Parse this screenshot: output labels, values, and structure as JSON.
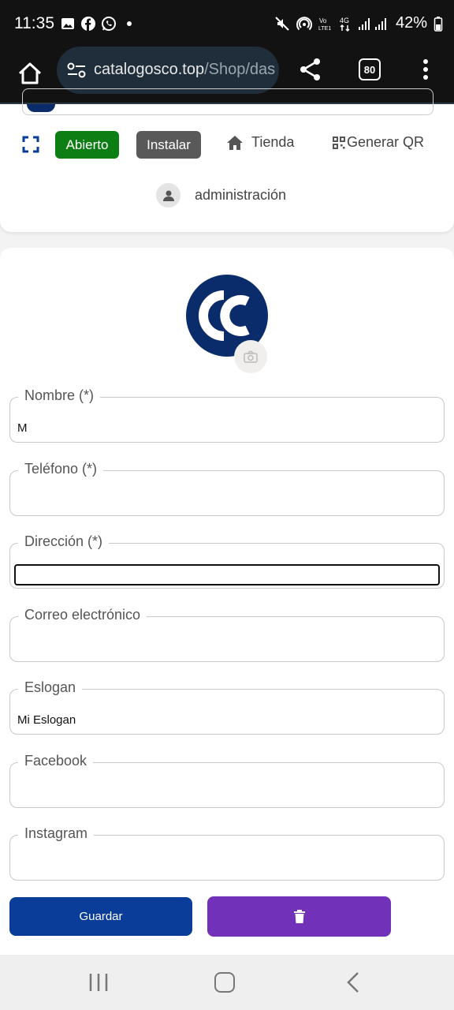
{
  "status_bar": {
    "time": "11:35",
    "battery": "42%",
    "icons": [
      "gallery-icon",
      "facebook-icon",
      "whatsapp-icon",
      "dot-icon",
      "mute-icon",
      "hotspot-icon",
      "volte-icon",
      "4g-icon",
      "signal-icon",
      "battery-icon"
    ]
  },
  "browser": {
    "url_host": "catalogosco.top",
    "url_path": "/Shop/das",
    "tab_count": "80"
  },
  "toolbar": {
    "status_label": "Abierto",
    "install_label": "Instalar",
    "store_label": "Tienda",
    "qr_label": "Generar QR",
    "admin_label": "administración"
  },
  "form": {
    "fields": [
      {
        "label": "Nombre (*)",
        "value": "M"
      },
      {
        "label": "Teléfono (*)",
        "value": ""
      },
      {
        "label": "Dirección (*)",
        "value": ""
      },
      {
        "label": "Correo electrónico",
        "value": ""
      },
      {
        "label": "Eslogan",
        "value": "Mi Eslogan"
      },
      {
        "label": "Facebook",
        "value": ""
      },
      {
        "label": "Instagram",
        "value": ""
      }
    ],
    "save_label": "Guardar"
  },
  "colors": {
    "status_open": "#0d7e13",
    "install": "#595959",
    "save": "#0a3d9a",
    "delete": "#7131b8",
    "logo": "#0b2c6b"
  }
}
